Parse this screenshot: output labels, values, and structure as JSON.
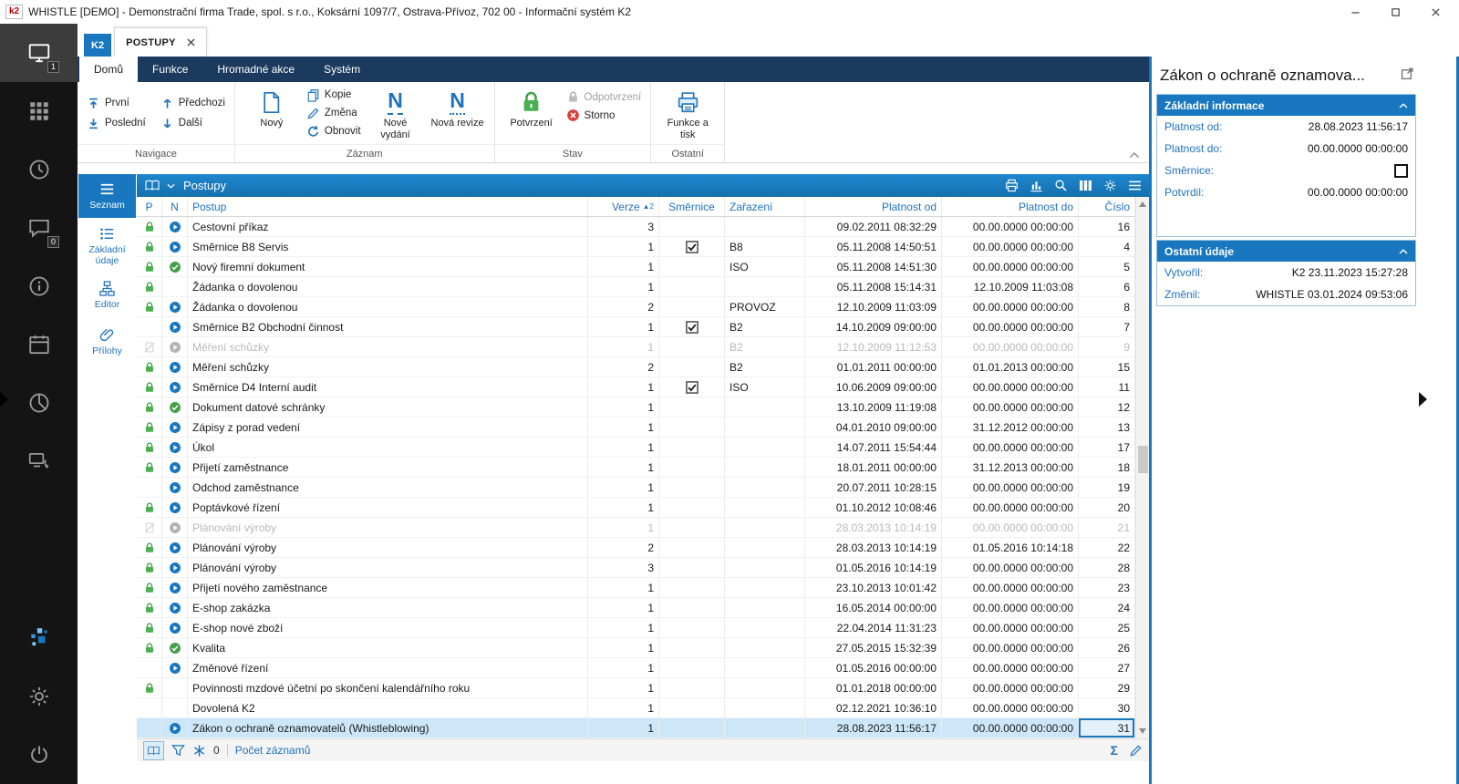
{
  "window": {
    "title": "WHISTLE [DEMO] - Demonstrační firma Trade, spol. s r.o., Koksární 1097/7, Ostrava-Přívoz, 702 00 - Informační systém K2",
    "logo": "k2"
  },
  "sidebar": {
    "top": [
      {
        "name": "workspace",
        "icon": "monitor",
        "active": true,
        "badge": "1"
      },
      {
        "name": "modules",
        "icon": "grid"
      },
      {
        "name": "history",
        "icon": "clock"
      },
      {
        "name": "messages",
        "icon": "chat",
        "badge": "0"
      },
      {
        "name": "info",
        "icon": "info"
      },
      {
        "name": "calendar",
        "icon": "calendar"
      },
      {
        "name": "reports",
        "icon": "pie"
      },
      {
        "name": "remote-support",
        "icon": "devicecall"
      }
    ],
    "bottom": [
      {
        "name": "k2-assistant",
        "icon": "sparkle"
      },
      {
        "name": "settings",
        "icon": "gear"
      },
      {
        "name": "power",
        "icon": "power"
      }
    ]
  },
  "tabs": [
    {
      "label": "K2"
    },
    {
      "label": "POSTUPY",
      "active": true
    }
  ],
  "ribbon": {
    "tabs": [
      {
        "label": "Domů",
        "active": true
      },
      {
        "label": "Funkce"
      },
      {
        "label": "Hromadné akce"
      },
      {
        "label": "Systém"
      }
    ],
    "groups": [
      {
        "label": "Navigace",
        "items": [
          {
            "label": "První"
          },
          {
            "label": "Předchozi"
          },
          {
            "label": "Poslední"
          },
          {
            "label": "Další"
          }
        ]
      },
      {
        "label": "Záznam",
        "items": [
          {
            "label": "Nový"
          },
          {
            "label": "Kopie"
          },
          {
            "label": "Změna"
          },
          {
            "label": "Obnovit"
          },
          {
            "label": "Nové vydání"
          },
          {
            "label": "Nová revize"
          }
        ]
      },
      {
        "label": "Stav",
        "items": [
          {
            "label": "Potvrzení"
          },
          {
            "label": "Odpotvrzení",
            "disabled": true
          },
          {
            "label": "Storno"
          }
        ]
      },
      {
        "label": "Ostatní",
        "items": [
          {
            "label": "Funkce a tisk"
          }
        ]
      }
    ]
  },
  "nav_panel": [
    {
      "name": "seznam",
      "label": "Seznam",
      "icon": "list",
      "active": true
    },
    {
      "name": "zakladni-udaje",
      "label": "Základní údaje",
      "icon": "details"
    },
    {
      "name": "editor",
      "label": "Editor",
      "icon": "editor"
    },
    {
      "name": "prilohy",
      "label": "Přílohy",
      "icon": "clip"
    }
  ],
  "table": {
    "title": "Postupy",
    "columns": [
      "P",
      "N",
      "Postup",
      "Verze",
      "Směrnice",
      "Zařazení",
      "Platnost od",
      "Platnost do",
      "Číslo"
    ],
    "sort": {
      "column": "Verze",
      "direction": "asc",
      "order": "2"
    },
    "rows": [
      {
        "p": "lock",
        "n": "play",
        "postup": "Cestovní příkaz",
        "verze": "3",
        "smernice": false,
        "zarazeni": "",
        "od": "09.02.2011 08:32:29",
        "do": "00.00.0000 00:00:00",
        "cislo": "16"
      },
      {
        "p": "lock",
        "n": "play",
        "postup": "Směrnice B8 Servis",
        "verze": "1",
        "smernice": true,
        "zarazeni": "B8",
        "od": "05.11.2008 14:50:51",
        "do": "00.00.0000 00:00:00",
        "cislo": "4"
      },
      {
        "p": "lock",
        "n": "check",
        "postup": "Nový firemní dokument",
        "verze": "1",
        "smernice": false,
        "zarazeni": "ISO",
        "od": "05.11.2008 14:51:30",
        "do": "00.00.0000 00:00:00",
        "cislo": "5"
      },
      {
        "p": "lock",
        "n": null,
        "postup": "Žádanka o dovolenou",
        "verze": "1",
        "smernice": false,
        "zarazeni": "",
        "od": "05.11.2008 15:14:31",
        "do": "12.10.2009 11:03:08",
        "cislo": "6"
      },
      {
        "p": "lock",
        "n": "play",
        "postup": "Žádanka o dovolenou",
        "verze": "2",
        "smernice": false,
        "zarazeni": "PROVOZ",
        "od": "12.10.2009 11:03:09",
        "do": "00.00.0000 00:00:00",
        "cislo": "8"
      },
      {
        "p": null,
        "n": "play",
        "postup": "Směrnice B2 Obchodní činnost",
        "verze": "1",
        "smernice": true,
        "zarazeni": "B2",
        "od": "14.10.2009 09:00:00",
        "do": "00.00.0000 00:00:00",
        "cislo": "7"
      },
      {
        "p": "banned",
        "n": "play",
        "dimmed": true,
        "postup": "Měření schůzky",
        "verze": "1",
        "smernice": false,
        "zarazeni": "B2",
        "od": "12.10.2009 11:12:53",
        "do": "00.00.0000 00:00:00",
        "cislo": "9"
      },
      {
        "p": "lock",
        "n": "play",
        "postup": "Měření schůzky",
        "verze": "2",
        "smernice": false,
        "zarazeni": "B2",
        "od": "01.01.2011 00:00:00",
        "do": "01.01.2013 00:00:00",
        "cislo": "15"
      },
      {
        "p": "lock",
        "n": "play",
        "postup": "Směrnice D4 Interní audit",
        "verze": "1",
        "smernice": true,
        "zarazeni": "ISO",
        "od": "10.06.2009 09:00:00",
        "do": "00.00.0000 00:00:00",
        "cislo": "11"
      },
      {
        "p": "lock",
        "n": "check",
        "postup": "Dokument datové schránky",
        "verze": "1",
        "smernice": false,
        "zarazeni": "",
        "od": "13.10.2009 11:19:08",
        "do": "00.00.0000 00:00:00",
        "cislo": "12"
      },
      {
        "p": "lock",
        "n": "play",
        "postup": "Zápisy z porad vedení",
        "verze": "1",
        "smernice": false,
        "zarazeni": "",
        "od": "04.01.2010 09:00:00",
        "do": "31.12.2012 00:00:00",
        "cislo": "13"
      },
      {
        "p": "lock",
        "n": "play",
        "postup": "Úkol",
        "verze": "1",
        "smernice": false,
        "zarazeni": "",
        "od": "14.07.2011 15:54:44",
        "do": "00.00.0000 00:00:00",
        "cislo": "17"
      },
      {
        "p": "lock",
        "n": "play",
        "postup": "Přijetí zaměstnance",
        "verze": "1",
        "smernice": false,
        "zarazeni": "",
        "od": "18.01.2011 00:00:00",
        "do": "31.12.2013 00:00:00",
        "cislo": "18"
      },
      {
        "p": null,
        "n": "play",
        "postup": "Odchod zaměstnance",
        "verze": "1",
        "smernice": false,
        "zarazeni": "",
        "od": "20.07.2011 10:28:15",
        "do": "00.00.0000 00:00:00",
        "cislo": "19"
      },
      {
        "p": "lock",
        "n": "play",
        "postup": "Poptávkové řízení",
        "verze": "1",
        "smernice": false,
        "zarazeni": "",
        "od": "01.10.2012 10:08:46",
        "do": "00.00.0000 00:00:00",
        "cislo": "20"
      },
      {
        "p": "banned",
        "n": "play",
        "dimmed": true,
        "postup": "Plánování výroby",
        "verze": "1",
        "smernice": false,
        "zarazeni": "",
        "od": "28.03.2013 10:14:19",
        "do": "00.00.0000 00:00:00",
        "cislo": "21"
      },
      {
        "p": "lock",
        "n": "play",
        "postup": "Plánování výroby",
        "verze": "2",
        "smernice": false,
        "zarazeni": "",
        "od": "28.03.2013 10:14:19",
        "do": "01.05.2016 10:14:18",
        "cislo": "22"
      },
      {
        "p": "lock",
        "n": "play",
        "postup": "Plánování výroby",
        "verze": "3",
        "smernice": false,
        "zarazeni": "",
        "od": "01.05.2016 10:14:19",
        "do": "00.00.0000 00:00:00",
        "cislo": "28"
      },
      {
        "p": "lock",
        "n": "play",
        "postup": "Přijetí nového zaměstnance",
        "verze": "1",
        "smernice": false,
        "zarazeni": "",
        "od": "23.10.2013 10:01:42",
        "do": "00.00.0000 00:00:00",
        "cislo": "23"
      },
      {
        "p": "lock",
        "n": "play",
        "postup": "E-shop zakázka",
        "verze": "1",
        "smernice": false,
        "zarazeni": "",
        "od": "16.05.2014 00:00:00",
        "do": "00.00.0000 00:00:00",
        "cislo": "24"
      },
      {
        "p": "lock",
        "n": "play",
        "postup": "E-shop nové zboží",
        "verze": "1",
        "smernice": false,
        "zarazeni": "",
        "od": "22.04.2014 11:31:23",
        "do": "00.00.0000 00:00:00",
        "cislo": "25"
      },
      {
        "p": "lock",
        "n": "check",
        "postup": "Kvalita",
        "verze": "1",
        "smernice": false,
        "zarazeni": "",
        "od": "27.05.2015 15:32:39",
        "do": "00.00.0000 00:00:00",
        "cislo": "26"
      },
      {
        "p": null,
        "n": "play",
        "postup": "Změnové řízení",
        "verze": "1",
        "smernice": false,
        "zarazeni": "",
        "od": "01.05.2016 00:00:00",
        "do": "00.00.0000 00:00:00",
        "cislo": "27"
      },
      {
        "p": "lock",
        "n": null,
        "postup": "Povinnosti mzdové účetní po skončení kalendářního roku",
        "verze": "1",
        "smernice": false,
        "zarazeni": "",
        "od": "01.01.2018 00:00:00",
        "do": "00.00.0000 00:00:00",
        "cislo": "29"
      },
      {
        "p": null,
        "n": null,
        "postup": "Dovolená K2",
        "verze": "1",
        "smernice": false,
        "zarazeni": "",
        "od": "02.12.2021 10:36:10",
        "do": "00.00.0000 00:00:00",
        "cislo": "30"
      },
      {
        "p": null,
        "n": "play",
        "selected": true,
        "postup": "Zákon o ochraně oznamovatelů (Whistleblowing)",
        "verze": "1",
        "smernice": false,
        "zarazeni": "",
        "od": "28.08.2023 11:56:17",
        "do": "00.00.0000 00:00:00",
        "cislo": "31"
      }
    ],
    "footer": {
      "filter_count": "0",
      "count_label": "Počet záznamů"
    }
  },
  "detail": {
    "title": "Zákon o ochraně oznamova...",
    "sections": [
      {
        "title": "Základní informace",
        "fields": [
          {
            "label": "Platnost od:",
            "value": "28.08.2023 11:56:17"
          },
          {
            "label": "Platnost do:",
            "value": "00.00.0000 00:00:00"
          },
          {
            "label": "Směrnice:",
            "checkbox": true,
            "checked": false
          },
          {
            "label": "Potvrdil:",
            "value": "00.00.0000 00:00:00"
          }
        ]
      },
      {
        "title": "Ostatní údaje",
        "fields": [
          {
            "label": "Vytvořil:",
            "value": "K2 23.11.2023 15:27:28"
          },
          {
            "label": "Změnil:",
            "value": "WHISTLE 03.01.2024 09:53:06"
          }
        ]
      }
    ]
  },
  "colors": {
    "accent": "#1877BE",
    "ribbon_bar": "#1C3A5E",
    "selected_row": "#CDE7F8",
    "confirm_green": "#43A047",
    "storno_red": "#D63A3A"
  }
}
